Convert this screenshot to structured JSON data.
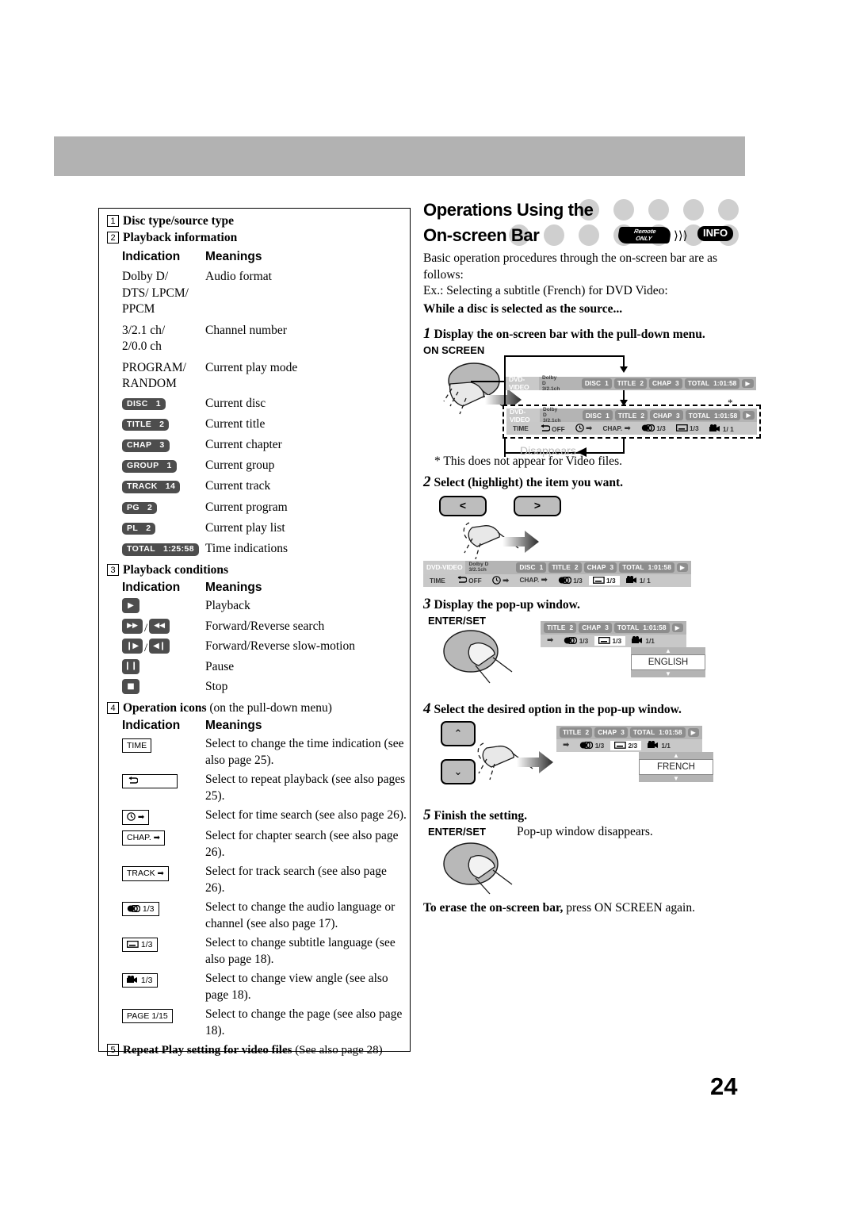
{
  "page": {
    "number": "24"
  },
  "left_panel": {
    "sections": [
      {
        "num": "1",
        "title": "Disc type/source type"
      },
      {
        "num": "2",
        "title": "Playback information"
      }
    ],
    "col_headers": {
      "indication": "Indication",
      "meanings": "Meanings"
    },
    "playback_information": [
      {
        "ind_lines": [
          "Dolby D/",
          "DTS/ LPCM/",
          "PPCM"
        ],
        "meaning": "Audio format"
      },
      {
        "ind_lines": [
          "3/2.1 ch/",
          "2/0.0 ch"
        ],
        "meaning": "Channel number"
      },
      {
        "ind_lines": [
          "PROGRAM/",
          "RANDOM"
        ],
        "meaning": "Current play mode"
      }
    ],
    "playback_badges": [
      {
        "label": "DISC",
        "value": "1",
        "meaning": "Current disc"
      },
      {
        "label": "TITLE",
        "value": "2",
        "meaning": "Current title"
      },
      {
        "label": "CHAP",
        "value": "3",
        "meaning": "Current chapter"
      },
      {
        "label": "GROUP",
        "value": "1",
        "meaning": "Current group"
      },
      {
        "label": "TRACK",
        "value": "14",
        "meaning": "Current track"
      },
      {
        "label": "PG",
        "value": "2",
        "meaning": "Current program"
      },
      {
        "label": "PL",
        "value": "2",
        "meaning": "Current play list"
      },
      {
        "label": "TOTAL",
        "value": "1:25:58",
        "meaning": "Time indications"
      }
    ],
    "section3": {
      "num": "3",
      "title": "Playback conditions"
    },
    "playback_conditions": [
      {
        "icons": [
          "play"
        ],
        "meaning": "Playback"
      },
      {
        "icons": [
          "ffwd",
          "rew"
        ],
        "meaning": "Forward/Reverse search"
      },
      {
        "icons": [
          "slowfwd",
          "slowrev"
        ],
        "meaning": "Forward/Reverse slow-motion"
      },
      {
        "icons": [
          "pause"
        ],
        "meaning": "Pause"
      },
      {
        "icons": [
          "stop"
        ],
        "meaning": "Stop"
      }
    ],
    "section4": {
      "num": "4",
      "title": "Operation icons ",
      "title_normal": "(on the pull-down menu)"
    },
    "operation_icons": [
      {
        "icon": "TIME",
        "icon_kind": "text",
        "meaning": "Select to change the time indication (see also page 25)."
      },
      {
        "icon": "repeat",
        "icon_kind": "repeat",
        "meaning": "Select to repeat playback (see also pages 25)."
      },
      {
        "icon": "time-search",
        "icon_kind": "clock-arrow",
        "meaning": "Select for time search (see also page 26)."
      },
      {
        "icon": "CHAP.",
        "icon_kind": "text-arrow",
        "meaning": "Select for chapter search (see also page 26)."
      },
      {
        "icon": "TRACK",
        "icon_kind": "text-arrow",
        "meaning": "Select for track search (see also page 26)."
      },
      {
        "icon": "audio",
        "icon_kind": "audio",
        "value": "1/3",
        "meaning": "Select to change the audio language or channel (see also page 17)."
      },
      {
        "icon": "subtitle",
        "icon_kind": "subtitle",
        "value": "1/3",
        "meaning": "Select to change subtitle language (see also page 18)."
      },
      {
        "icon": "angle",
        "icon_kind": "angle",
        "value": "1/3",
        "meaning": "Select to change view angle (see also page 18)."
      },
      {
        "icon": "PAGE 1/15",
        "icon_kind": "text",
        "meaning": "Select to change the page (see also page 18)."
      }
    ],
    "section5": {
      "num": "5",
      "title": "Repeat Play setting for video files ",
      "title_normal": "(See also page 28)"
    }
  },
  "right_panel": {
    "title_line1": "Operations Using the",
    "title_line2": "On-screen Bar",
    "remote_badge_line1": "Remote",
    "remote_badge_line2": "ONLY",
    "info_badge": "INFO",
    "intro1": "Basic operation procedures through the on-screen bar are as follows:",
    "intro2": "Ex.: Selecting a subtitle (French) for DVD Video:",
    "intro3": "While a disc is selected as the source...",
    "steps": [
      {
        "num": "1",
        "text": "Display the on-screen bar with the pull-down menu."
      },
      {
        "num": "2",
        "text": "Select (highlight) the item you want."
      },
      {
        "num": "3",
        "text": "Display the pop-up window."
      },
      {
        "num": "4",
        "text": "Select the desired option in the pop-up window."
      },
      {
        "num": "5",
        "text": "Finish the setting."
      }
    ],
    "key_on_screen": "ON SCREEN",
    "key_enter_set_1": "ENTER/SET",
    "key_enter_set_2": "ENTER/SET",
    "disappears": "Disappears",
    "footnote": "* This does not appear for Video files.",
    "popup_disappears": "Pop-up window disappears.",
    "erase_bold": "To erase the on-screen bar,",
    "erase_rest": " press ON SCREEN again.",
    "asterisk": "*",
    "btn_left": "<",
    "btn_right": ">"
  },
  "osd_bar": {
    "source": "DVD-VIDEO",
    "format_line1": "Dolby D",
    "format_line2": "3/2.1ch",
    "chips": [
      {
        "label": "DISC",
        "value": "1"
      },
      {
        "label": "TITLE",
        "value": "2"
      },
      {
        "label": "CHAP",
        "value": "3"
      },
      {
        "label": "TOTAL",
        "value": "1:01:58"
      }
    ],
    "menu_items": [
      {
        "label": "TIME"
      },
      {
        "label": "OFF",
        "icon": "repeat"
      },
      {
        "label": "",
        "icon": "clock-arrow"
      },
      {
        "label": "CHAP.",
        "icon": "arrow"
      },
      {
        "label": "1/3",
        "icon": "audio"
      },
      {
        "label": "1/3",
        "icon": "subtitle"
      },
      {
        "label": "1/ 1",
        "icon": "angle"
      }
    ],
    "step3_subtitle_value": "1/3",
    "step4_subtitle_value": "2/3",
    "step3_popup": "ENGLISH",
    "step4_popup": "FRENCH",
    "angle_value_short": "1/1",
    "audio_value": "1/3"
  }
}
